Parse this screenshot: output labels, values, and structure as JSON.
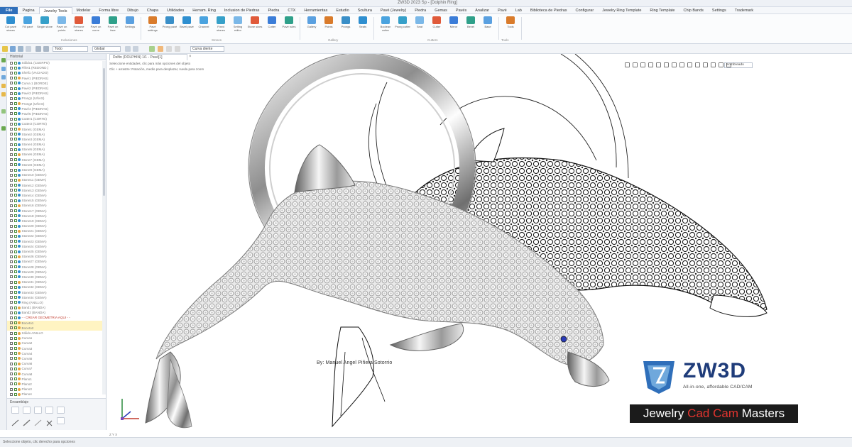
{
  "window": {
    "title": "ZW3D 2023 Sp - [Dolphin Ring]"
  },
  "menu": {
    "file_tab": "File",
    "tabs": [
      "Pagina",
      "Jewelry Tools",
      "Modelar",
      "Forma libre",
      "Dibujo",
      "Chapa",
      "Utilidades",
      "Herram. Ring",
      "Inclusion de Piedras",
      "Piedra",
      "CTX",
      "Herramientas",
      "Estudio",
      "Scultura",
      "Pavé (Jewelry)",
      "Piedra",
      "Gemas",
      "Pavés",
      "Analizar",
      "Pavé",
      "Lab",
      "Biblioteca de Piedras",
      "Configurar",
      "Jewelry Ring Template",
      "Ring Template",
      "Chip Bands",
      "Settings",
      "Trademark"
    ],
    "active_index": 1
  },
  "ribbon": {
    "groups": [
      {
        "label": "Inclusiones",
        "items": [
          "Cut pavé stones",
          "Fill pavé",
          "Single stone",
          "Pavé on points",
          "Remove stones",
          "Pavé on curve",
          "Pavé on face",
          "Settings"
        ]
      },
      {
        "label": "Stones",
        "items": [
          "Pavé settings",
          "Prong pavé",
          "Bezel pavé",
          "Channel",
          "Fixed stones",
          "Setting editor",
          "Stone sizes",
          "Cutter",
          "Pavé rules"
        ]
      },
      {
        "label": "Gallery",
        "items": [
          "Gallery",
          "Points",
          "Prongs",
          "Seats"
        ]
      },
      {
        "label": "Cutters",
        "items": [
          "Boolean cutter",
          "Prong cutter",
          "Seat",
          "Cutter",
          "Mirror",
          "Bevel",
          "Base"
        ]
      },
      {
        "label": "Tools",
        "items": [
          "Tools"
        ]
      }
    ]
  },
  "toolbar2": {
    "filter_value": "Todo",
    "layer_value": "Global",
    "selector_value": "Curva diente"
  },
  "history_panel": {
    "title": "Historial",
    "rows": [
      "Sólido1 (CUERPO)",
      "Fillet1 (REDOND.)",
      "Shell1 (VACIADO)",
      "Pavé1 (PIEDRAS)",
      "Curva 1 (BORDE)",
      "Pavé2 (PIEDRAS)",
      "Pavé3 (PIEDRAS)",
      "Prong1 (UÑAS)",
      "Prong2 (UÑAS)",
      "Pavé4 (PIEDRAS)",
      "Pavé5 (PIEDRAS)",
      "Cutter1 (CORTE)",
      "Cutter2 (CORTE)",
      "Stone1 (GEMA)",
      "Stone2 (GEMA)",
      "Stone3 (GEMA)",
      "Stone4 (GEMA)",
      "Stone5 (GEMA)",
      "Stone6 (GEMA)",
      "Stone7 (GEMA)",
      "Stone8 (GEMA)",
      "Stone9 (GEMA)",
      "Stone10 (GEMA)",
      "Stone11 (GEMA)",
      "Stone12 (GEMA)",
      "Stone13 (GEMA)",
      "Stone14 (GEMA)",
      "Stone15 (GEMA)",
      "Stone16 (GEMA)",
      "Stone17 (GEMA)",
      "Stone18 (GEMA)",
      "Stone19 (GEMA)",
      "Stone20 (GEMA)",
      "Stone21 (GEMA)",
      "Stone22 (GEMA)",
      "Stone23 (GEMA)",
      "Stone24 (GEMA)",
      "Stone25 (GEMA)",
      "Stone26 (GEMA)",
      "Stone27 (GEMA)",
      "Stone28 (GEMA)",
      "Stone29 (GEMA)",
      "Stone30 (GEMA)",
      "Stone31 (GEMA)",
      "Stone32 (GEMA)",
      "Stone33 (GEMA)",
      "Stone34 (GEMA)",
      "Ring (ANILLO)",
      "Band1 (BANDA)",
      "Band2 (BANDA)"
    ],
    "selected_row": "- - CREAR GEOMETRIA AQUI - -",
    "tail_rows": [
      "Boceto1",
      "Boceto2",
      "Sólido ANILLO",
      "Curva1",
      "Curva2",
      "Curva3",
      "Curva4",
      "Curva5",
      "Curva6",
      "Curva7",
      "Curva8",
      "Plano1",
      "Plano2",
      "Plano3",
      "Plano4"
    ],
    "footer_title": "Ensamblaje"
  },
  "viewport": {
    "document_tab": "Delfin (DOLPHIN) 1/1 - Pavé[1]",
    "hint_1": "Seleccione entidades, clic para más opciones del objeto",
    "hint_2": "Clic + arrastre: Rotación, medio para desplazar, rueda para zoom",
    "view_mode": "Sombreado",
    "coords_label": "Z  Y  X"
  },
  "credit": "By: Manuel Angel Piñera Sotorrio",
  "logo": {
    "zw_prefix": "ZW",
    "zw_suffix": "3D",
    "zw_tagline": "All-in-one, affordable CAD/CAM",
    "banner_part1": "Jewelry ",
    "banner_part2": "Cad Cam",
    "banner_part3": " Masters"
  },
  "status": {
    "text": "Seleccione objeto, clic derecho para opciones"
  },
  "colors": {
    "file_tab": "#2f6fba",
    "brand_blue": "#1f3c7a",
    "banner_red": "#e2342f",
    "banner_bg": "#1b1b1b",
    "gem_blue": "#2a3bb8"
  }
}
